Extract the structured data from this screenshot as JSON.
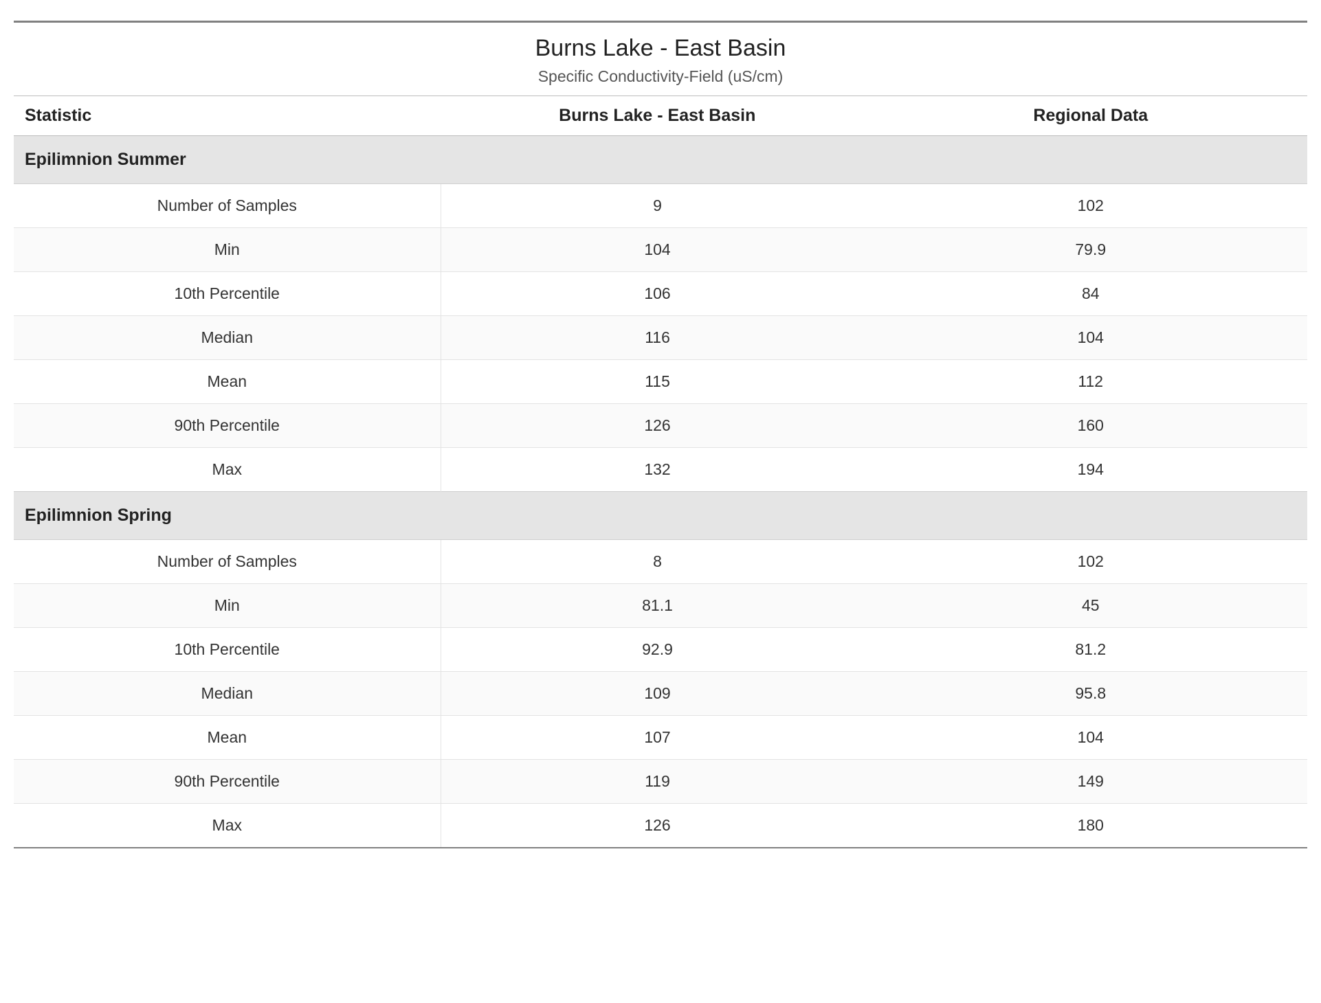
{
  "title": "Burns Lake - East Basin",
  "subtitle": "Specific Conductivity-Field (uS/cm)",
  "columns": {
    "stat": "Statistic",
    "site": "Burns Lake - East Basin",
    "regional": "Regional Data"
  },
  "groups": [
    {
      "name": "Epilimnion Summer",
      "rows": [
        {
          "stat": "Number of Samples",
          "site": "9",
          "regional": "102"
        },
        {
          "stat": "Min",
          "site": "104",
          "regional": "79.9"
        },
        {
          "stat": "10th Percentile",
          "site": "106",
          "regional": "84"
        },
        {
          "stat": "Median",
          "site": "116",
          "regional": "104"
        },
        {
          "stat": "Mean",
          "site": "115",
          "regional": "112"
        },
        {
          "stat": "90th Percentile",
          "site": "126",
          "regional": "160"
        },
        {
          "stat": "Max",
          "site": "132",
          "regional": "194"
        }
      ]
    },
    {
      "name": "Epilimnion Spring",
      "rows": [
        {
          "stat": "Number of Samples",
          "site": "8",
          "regional": "102"
        },
        {
          "stat": "Min",
          "site": "81.1",
          "regional": "45"
        },
        {
          "stat": "10th Percentile",
          "site": "92.9",
          "regional": "81.2"
        },
        {
          "stat": "Median",
          "site": "109",
          "regional": "95.8"
        },
        {
          "stat": "Mean",
          "site": "107",
          "regional": "104"
        },
        {
          "stat": "90th Percentile",
          "site": "119",
          "regional": "149"
        },
        {
          "stat": "Max",
          "site": "126",
          "regional": "180"
        }
      ]
    }
  ]
}
